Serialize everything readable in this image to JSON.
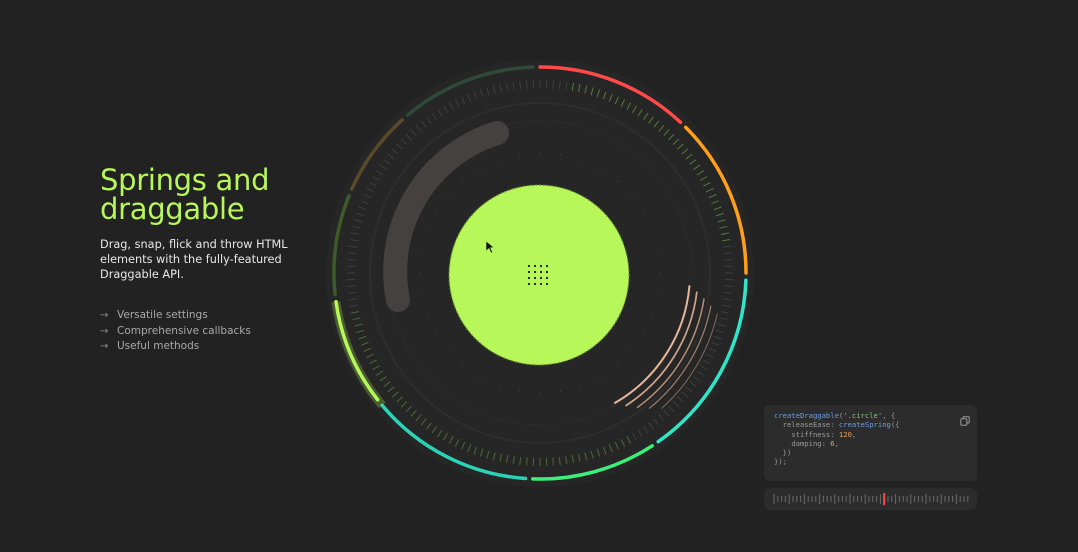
{
  "hero": {
    "title_line1": "Springs and",
    "title_line2": "draggable",
    "description": "Drag, snap, flick and throw HTML elements with the fully-featured Draggable API."
  },
  "features": [
    {
      "icon": "arrow-right-icon",
      "label": "Versatile settings"
    },
    {
      "icon": "arrow-right-icon",
      "label": "Comprehensive callbacks"
    },
    {
      "icon": "arrow-right-icon",
      "label": "Useful methods"
    }
  ],
  "code": {
    "line1_fn": "createDraggable",
    "line1_str": "'.circle'",
    "line1_rest": ", {",
    "line2_key": "releaseEase: ",
    "line2_fn": "createSpring",
    "line2_rest": "({",
    "line3_key": "stiffness: ",
    "line3_num": "120",
    "line4_key": "damping: ",
    "line4_num": "6",
    "line5": "})",
    "line6": "});"
  },
  "icons": {
    "copy": "copy-icon",
    "cursor": "cursor-arrow-icon",
    "drag_handle": "drag-handle-dots-icon"
  },
  "colors": {
    "background": "#222222",
    "accent": "#b7f75a",
    "ring_red": "#ff4a4a",
    "ring_orange": "#ff9f1c",
    "ring_teal": "#2ee6c8",
    "ring_green": "#3bf07a",
    "ring_lime": "#b7f75a",
    "trail_peach": "#ffc9a6",
    "panel": "#2c2c2c"
  }
}
